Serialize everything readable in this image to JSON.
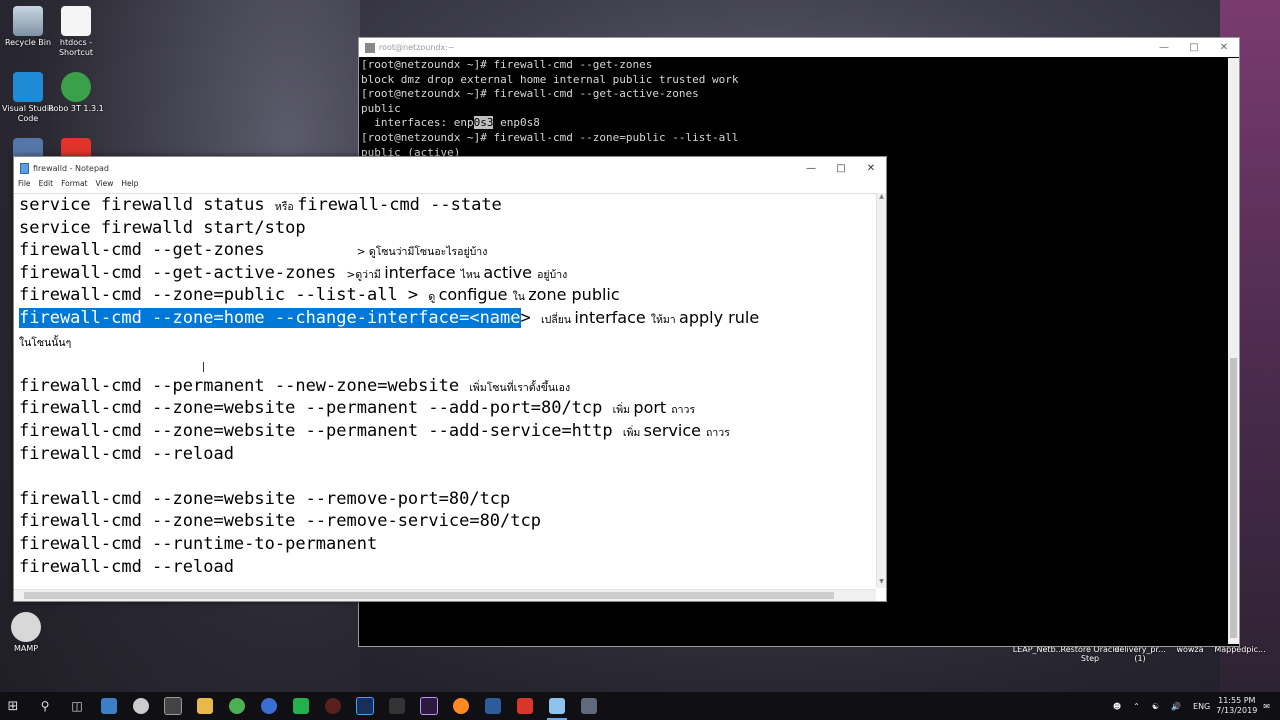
{
  "desktop": {
    "icons": [
      {
        "label": "Recycle Bin"
      },
      {
        "label": "htdocs - Shortcut"
      },
      {
        "label": "Visual Studio Code"
      },
      {
        "label": "Robo 3T 1.3.1"
      },
      {
        "label": "MAMP"
      }
    ],
    "bottom_labels": [
      "LEAP_Netb...",
      "Restore Oracle Step",
      "delivery_pr... (1)",
      "wowza",
      "Mappedpic..."
    ]
  },
  "terminal": {
    "title": "root@netzoundx:~",
    "lines": [
      "[root@netzoundx ~]# firewall-cmd --get-zones",
      "block dmz drop external home internal public trusted work",
      "[root@netzoundx ~]# firewall-cmd --get-active-zones",
      "public",
      "[root@netzoundx ~]# firewall-cmd --zone=public --list-all",
      "public (active)"
    ],
    "iface_prefix": "  interfaces: enp",
    "iface_highlight": "0s3",
    "iface_suffix": " enp0s8"
  },
  "notepad": {
    "title": "firewalld - Notepad",
    "menu": [
      "File",
      "Edit",
      "Format",
      "View",
      "Help"
    ],
    "l1": {
      "a": "service firewalld status ",
      "th": "หรือ ",
      "b": "firewall-cmd --state"
    },
    "l2": "service firewalld start/stop",
    "l3": {
      "a": "firewall-cmd --get-zones         ",
      "th": "> ดูโซนว่ามีโซนอะไรอยู่บ้าง"
    },
    "l4": {
      "a": "firewall-cmd --get-active-zones ",
      "th1": ">ดูว่ามี ",
      "en1": "interface ",
      "th2": "ไหน ",
      "en2": "active ",
      "th3": "อยู่บ้าง"
    },
    "l5": {
      "a": "firewall-cmd --zone=public --list-all > ",
      "th1": "ดู ",
      "en1": "configue ",
      "th2": "ใน ",
      "en2": "zone public"
    },
    "l6": {
      "sel": "firewall-cmd --zone=home --change-interface=<name",
      "a": "> ",
      "th1": "เปลี่ยน ",
      "en1": "interface ",
      "th2": "ให้มา ",
      "en2": "apply rule"
    },
    "l7": "ในโซนนั้นๆ",
    "l9": {
      "a": "firewall-cmd --permanent --new-zone=website ",
      "th": "เพิ่มโซนที่เราตั้งขึ้นเอง"
    },
    "l10": {
      "a": "firewall-cmd --zone=website --permanent --add-port=80/tcp ",
      "th1": "เพิ่ม ",
      "en": "port ",
      "th2": "ถาวร"
    },
    "l11": {
      "a": "firewall-cmd --zone=website --permanent --add-service=http ",
      "th1": "เพิ่ม ",
      "en": "service ",
      "th2": "ถาวร"
    },
    "l12": "firewall-cmd --reload",
    "l14": "firewall-cmd --zone=website --remove-port=80/tcp",
    "l15": "firewall-cmd --zone=website --remove-service=80/tcp",
    "l16": "firewall-cmd --runtime-to-permanent",
    "l17": "firewall-cmd --reload"
  },
  "taskbar": {
    "lang": "ENG",
    "time": "11:55 PM",
    "date": "7/13/2019"
  },
  "colors": {
    "selection": "#0078d7",
    "terminal_bg": "#000000",
    "taskbar_bg": "#101014"
  }
}
